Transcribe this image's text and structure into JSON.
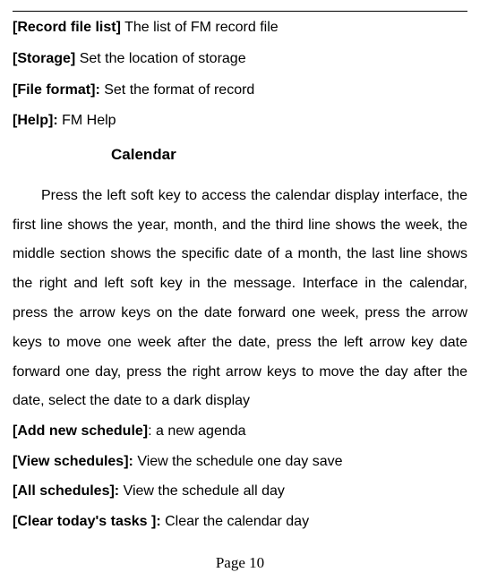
{
  "top_items": [
    {
      "label": "[Record file list]",
      "sep": " ",
      "desc": "The list of FM record file"
    },
    {
      "label": "[Storage]",
      "sep": " ",
      "desc": "Set the location of storage"
    },
    {
      "label": "[File format]:",
      "sep": " ",
      "desc": "Set the format of record"
    },
    {
      "label": "[Help]:",
      "sep": " ",
      "desc": "FM Help"
    }
  ],
  "heading": "Calendar",
  "paragraph": "Press the left soft key to access the calendar display interface, the first line shows the year, month, and the third line shows the week, the middle section shows the specific date of a month, the last line shows the right and left soft key in the message. Interface in the calendar, press the arrow keys on the date forward one week, press the arrow keys to move one week after the date, press the left arrow key date forward one day, press the right arrow keys to move the day after the date, select the date to a dark display",
  "bottom_items": [
    {
      "label": "[Add new schedule]",
      "sep": ": ",
      "desc": "a new agenda"
    },
    {
      "label": "[View schedules]:",
      "sep": " ",
      "desc": "View the schedule one day save"
    },
    {
      "label": "[All schedules]:",
      "sep": " ",
      "desc": "View the schedule all day"
    },
    {
      "label": "[Clear today's tasks ]:",
      "sep": " ",
      "desc": "Clear the calendar day"
    }
  ],
  "page_number": "Page 10"
}
